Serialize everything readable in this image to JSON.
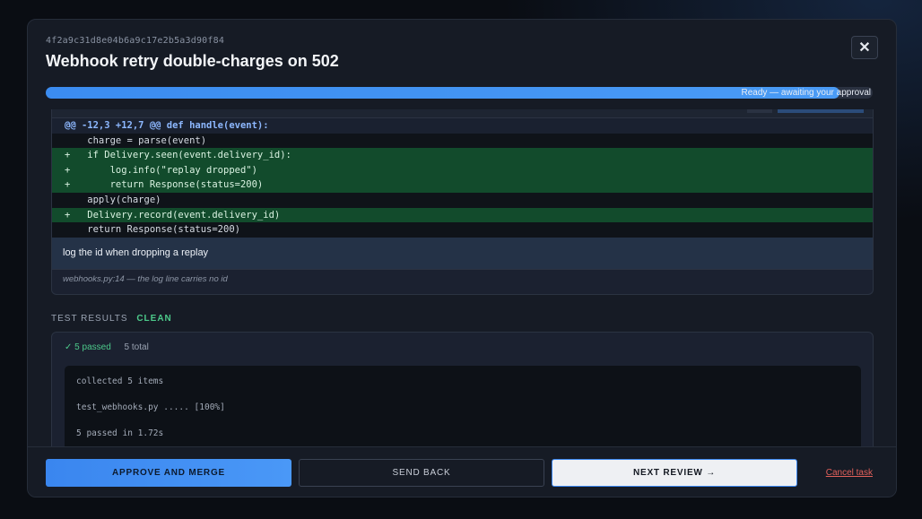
{
  "task": {
    "id": "4f2a9c31d8e04b6a9c17e2b5a3d90f84",
    "title": "Webhook retry double-charges on 502"
  },
  "progress": {
    "percent": 96,
    "label": "Ready — awaiting your approval"
  },
  "diff": {
    "lines": [
      {
        "type": "hunk",
        "text": "@@ -12,3 +12,7 @@ def handle(event):"
      },
      {
        "type": "ctx",
        "text": "    charge = parse(event)"
      },
      {
        "type": "add",
        "text": "+   if Delivery.seen(event.delivery_id):"
      },
      {
        "type": "add",
        "text": "+       log.info(\"replay dropped\")"
      },
      {
        "type": "add",
        "text": "+       return Response(status=200)"
      },
      {
        "type": "ctx",
        "text": "    apply(charge)"
      },
      {
        "type": "add",
        "text": "+   Delivery.record(event.delivery_id)"
      },
      {
        "type": "ctx",
        "text": "    return Response(status=200)"
      }
    ],
    "comment": "log the id when dropping a replay",
    "comment_ref": "webhooks.py:14 — the log line carries no id"
  },
  "tests": {
    "section_label": "TEST RESULTS",
    "status": "CLEAN",
    "passed_label": "5 passed",
    "total_label": "5 total",
    "console": [
      "collected 5 items",
      "test_webhooks.py .....              [100%]",
      "5 passed in 1.72s"
    ]
  },
  "footer": {
    "approve_label": "APPROVE AND MERGE",
    "send_back_label": "SEND BACK",
    "next_label": "NEXT REVIEW →",
    "cancel_label": "Cancel task"
  },
  "colors": {
    "accent": "#3b8cf0",
    "added_line": "#124b2c",
    "pass": "#4cc98a",
    "danger": "#e0605a"
  }
}
